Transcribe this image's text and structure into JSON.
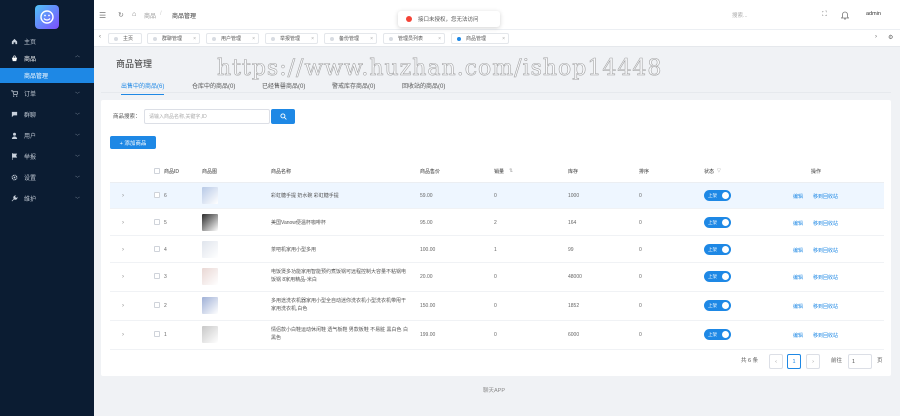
{
  "sidebar": {
    "items": [
      {
        "label": "主页",
        "icon": "home-icon"
      },
      {
        "label": "商品",
        "icon": "bag-icon",
        "open": true,
        "sub": "商品管理"
      },
      {
        "label": "订单",
        "icon": "cart-icon"
      },
      {
        "label": "群聊",
        "icon": "chat-icon"
      },
      {
        "label": "用户",
        "icon": "user-icon"
      },
      {
        "label": "举报",
        "icon": "flag-icon"
      },
      {
        "label": "设置",
        "icon": "gear-icon"
      },
      {
        "label": "维护",
        "icon": "wrench-icon"
      }
    ]
  },
  "header": {
    "breadcrumb_home": "商品",
    "breadcrumb_current": "商品管理",
    "search_placeholder": "搜索...",
    "username": "admin"
  },
  "toast": {
    "message": "接口未授权，您无法访问"
  },
  "tabs": [
    "主页",
    "群聊管理",
    "用户管理",
    "举报管理",
    "备份管理",
    "管理员列表",
    "商品管理"
  ],
  "page": {
    "title": "商品管理",
    "subtabs": [
      "出售中的商品(6)",
      "仓库中的商品(0)",
      "已经售罄商品(0)",
      "警戒库存商品(0)",
      "回收站的商品(0)"
    ],
    "search_label": "商品搜索：",
    "search_placeholder": "请输入商品名称,关键字,ID",
    "add_button": "+ 添加商品"
  },
  "table": {
    "headers": [
      "商品ID",
      "商品图",
      "商品名称",
      "商品售价",
      "销量",
      "库存",
      "排序",
      "状态",
      "操作"
    ],
    "rows": [
      {
        "id": "6",
        "name": "彩虹糖手提 奶水碗 彩虹糖手提",
        "price": "59.00",
        "sales": "0",
        "stock": "1000",
        "sort": "0",
        "status": "上架",
        "thumb": "#b7c9e6"
      },
      {
        "id": "5",
        "name": "美国Vanow便温杯咖啡杯",
        "price": "95.00",
        "sales": "2",
        "stock": "164",
        "sort": "0",
        "status": "上架",
        "thumb": "#2b2b2b"
      },
      {
        "id": "4",
        "name": "茶吧机家用小型多用",
        "price": "100.00",
        "sales": "1",
        "stock": "99",
        "sort": "0",
        "status": "上架",
        "thumb": "#dfe4ec"
      },
      {
        "id": "3",
        "name": "电饭煲多功能家用智能预约煮饭锅可远程控制大容量不粘锅电饭锅 8家用精品-米白",
        "price": "20.00",
        "sales": "0",
        "stock": "48000",
        "sort": "0",
        "status": "上架",
        "thumb": "#e9d7d4"
      },
      {
        "id": "2",
        "name": "多用途洗衣机器家用小型全自动迷你洗衣机小型洗衣机带甩干 家用洗衣机,白色",
        "price": "150.00",
        "sales": "0",
        "stock": "1852",
        "sort": "0",
        "status": "上架",
        "thumb": "#9fb0d6"
      },
      {
        "id": "1",
        "name": "情侣款小白鞋运动休闲鞋 透气板鞋 男款板鞋 不易脏 黑白色 白黑色",
        "price": "199.00",
        "sales": "0",
        "stock": "6000",
        "sort": "0",
        "status": "上架",
        "thumb": "#c8c8c8"
      }
    ],
    "action_edit": "编辑",
    "action_recycle": "移到回收站"
  },
  "pagination": {
    "total": "共 6 条",
    "current": "1",
    "goto_label": "前往",
    "goto_value": "1",
    "page_unit": "页"
  },
  "footer": "聊天APP",
  "watermark": "https://www.huzhan.com/ishop14448"
}
